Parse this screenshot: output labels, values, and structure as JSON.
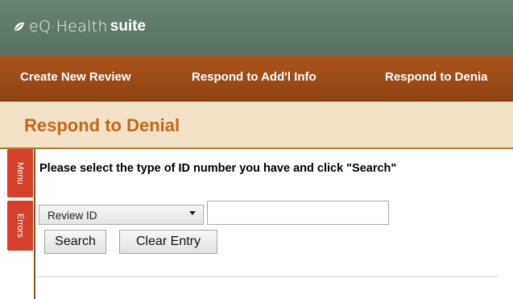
{
  "header": {
    "logo_eq": "eQ·Health",
    "logo_suite": "suite",
    "logo_icon": "leaf-icon"
  },
  "nav": {
    "items": [
      {
        "label": "Create New Review"
      },
      {
        "label": "Respond to Add'l Info"
      },
      {
        "label": "Respond to Denia"
      }
    ]
  },
  "page": {
    "title": "Respond to Denial"
  },
  "side_tabs": {
    "menu_label": "Menu",
    "errors_label": "Errors"
  },
  "form": {
    "instruction": "Please select the type of ID number you have and click \"Search\"",
    "id_type_selected": "Review ID",
    "id_input_value": "",
    "search_label": "Search",
    "clear_label": "Clear Entry"
  },
  "colors": {
    "header_bg": "#5f7a6a",
    "nav_bg": "#a0501b",
    "title_bg": "#f3e2c5",
    "title_text": "#c0681c",
    "side_tab_bg": "#d5402b"
  }
}
